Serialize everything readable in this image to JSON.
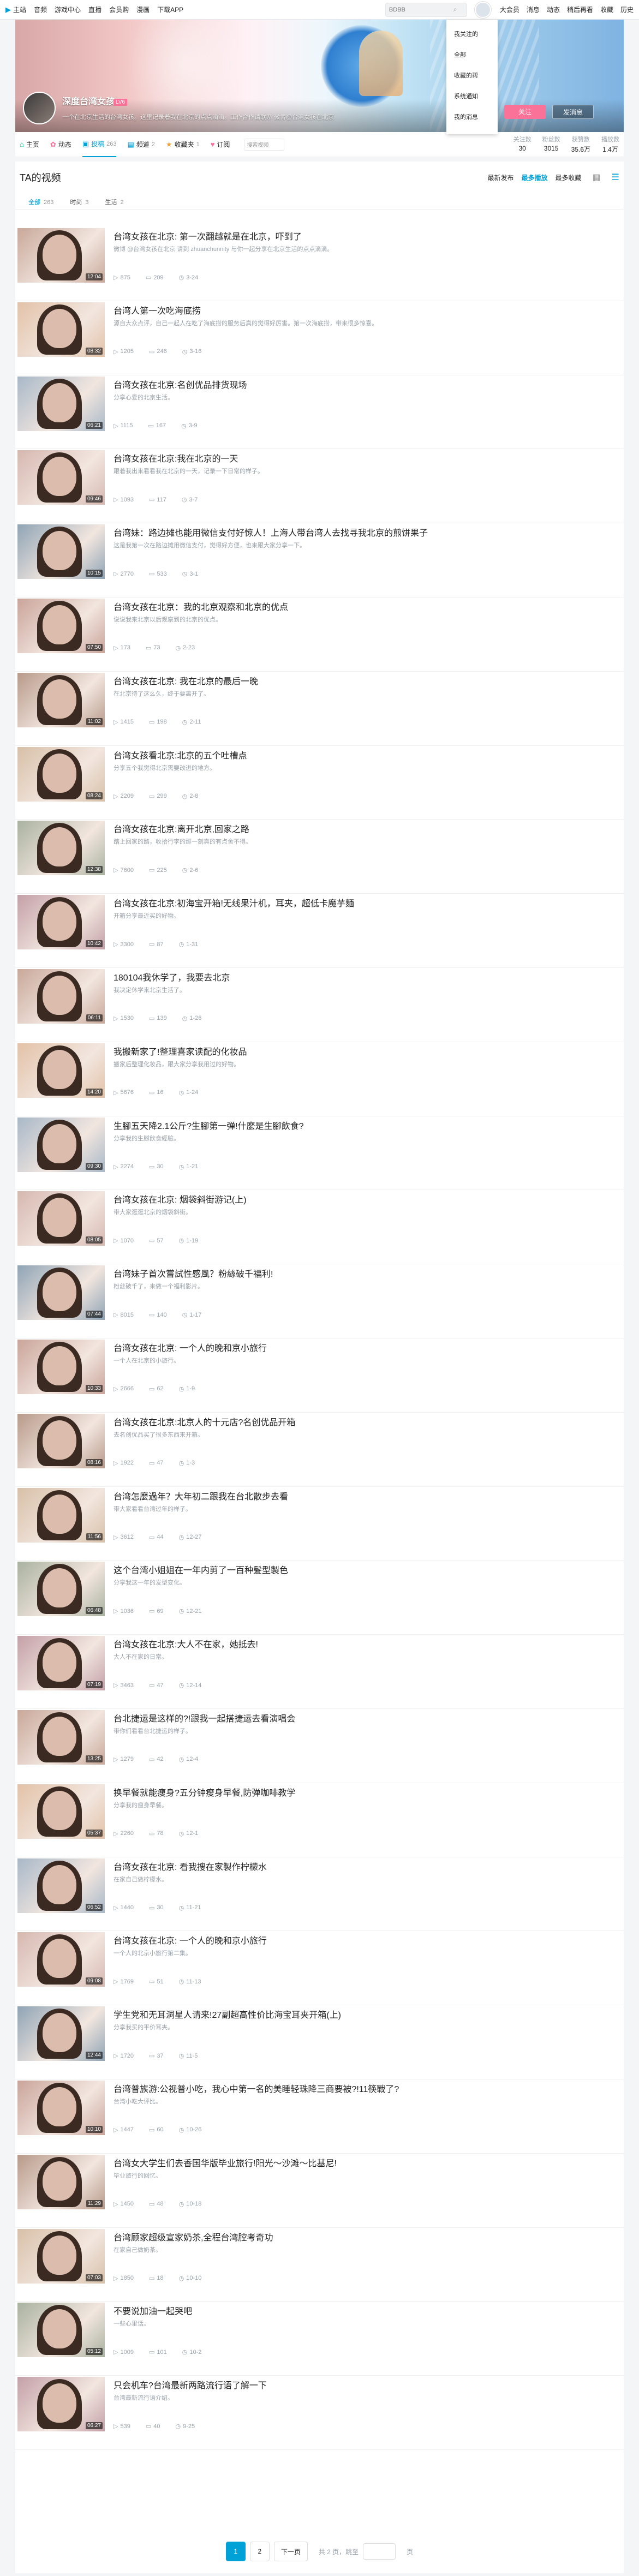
{
  "topbar": {
    "links": [
      "主站",
      "音频",
      "游戏中心",
      "直播",
      "会员购",
      "漫画",
      "下载APP"
    ],
    "search_placeholder": "BDBB",
    "right": [
      "大会员",
      "消息",
      "动态",
      "稍后再看",
      "收藏",
      "历史"
    ]
  },
  "dropdown": {
    "items": [
      "我关注的",
      "全部",
      "收藏的帮",
      "系统通知",
      "我的消息"
    ]
  },
  "banner": {
    "username": "深度台湾女孩",
    "level": "LV6",
    "sign": "一个在北京生活的台湾女孩。这里记录着我在北京的点点滴滴。工作合作请联系 微博@台湾女孩在北京",
    "follow": "关注",
    "message": "发消息"
  },
  "nav": {
    "tabs": [
      {
        "label": "主页",
        "count": ""
      },
      {
        "label": "动态",
        "count": ""
      },
      {
        "label": "投稿",
        "count": "263"
      },
      {
        "label": "频道",
        "count": "2"
      },
      {
        "label": "收藏夹",
        "count": "1"
      },
      {
        "label": "订阅",
        "count": ""
      }
    ],
    "search_placeholder": "搜索视频",
    "stats": [
      {
        "label": "关注数",
        "value": "30"
      },
      {
        "label": "粉丝数",
        "value": "3015"
      },
      {
        "label": "获赞数",
        "value": "35.6万"
      },
      {
        "label": "播放数",
        "value": "1.4万"
      }
    ]
  },
  "main": {
    "title": "TA的视频",
    "sorts": [
      "最新发布",
      "最多播放",
      "最多收藏"
    ],
    "filters": [
      {
        "label": "全部",
        "count": "263"
      },
      {
        "label": "时尚",
        "count": "3"
      },
      {
        "label": "生活",
        "count": "2"
      }
    ]
  },
  "videos": [
    {
      "title": "台湾女孩在北京: 第一次翻越就是在北京，吓到了",
      "desc": "微博 @台湾女孩在北京 请到 zhuanchunnity 与你一起分享在北京生活的点点滴滴。",
      "plays": "875",
      "comments": "209",
      "date": "3-24",
      "dur": "12:04"
    },
    {
      "title": "台湾人第一次吃海底捞",
      "desc": "源自大众点评，自己一起人在吃了海底捞的服务后真的觉得好厉害。第一次海底捞，带来很多惊喜。",
      "plays": "1205",
      "comments": "246",
      "date": "3-16",
      "dur": "08:32"
    },
    {
      "title": "台湾女孩在北京:名创优品排货现场",
      "desc": "分享心爱的北京生活。",
      "plays": "1115",
      "comments": "167",
      "date": "3-9",
      "dur": "06:21"
    },
    {
      "title": "台湾女孩在北京:我在北京的一天",
      "desc": "跟着我出来看看我在北京的一天，记录一下日常的样子。",
      "plays": "1093",
      "comments": "117",
      "date": "3-7",
      "dur": "09:46"
    },
    {
      "title": "台湾妹：路边摊也能用微信支付好惊人！上海人带台湾人去找寻我北京的煎饼果子",
      "desc": "这是我第一次在路边摊用微信支付，觉得好方便，也来跟大家分享一下。",
      "plays": "2770",
      "comments": "533",
      "date": "3-1",
      "dur": "10:15"
    },
    {
      "title": "台湾女孩在北京：我的北京观察和北京的优点",
      "desc": "说说我来北京以后观察到的北京的优点。",
      "plays": "173",
      "comments": "73",
      "date": "2-23",
      "dur": "07:50"
    },
    {
      "title": "台湾女孩在北京: 我在北京的最后一晚",
      "desc": "在北京待了这么久，终于要离开了。",
      "plays": "1415",
      "comments": "198",
      "date": "2-11",
      "dur": "11:02"
    },
    {
      "title": "台湾女孩看北京:北京的五个吐槽点",
      "desc": "分享五个我觉得北京需要改进的地方。",
      "plays": "2209",
      "comments": "299",
      "date": "2-8",
      "dur": "08:24"
    },
    {
      "title": "台湾女孩在北京:离开北京,回家之路",
      "desc": "踏上回家的路，收拾行李的那一刻真的有点舍不得。",
      "plays": "7600",
      "comments": "225",
      "date": "2-6",
      "dur": "12:38"
    },
    {
      "title": "台湾女孩在北京:初海宝开箱!无线果汁机，耳夹，超低卡魔芋麵",
      "desc": "开箱分享最近买的好物。",
      "plays": "3300",
      "comments": "87",
      "date": "1-31",
      "dur": "10:42"
    },
    {
      "title": "180104我休学了，我要去北京",
      "desc": "我决定休学来北京生活了。",
      "plays": "1530",
      "comments": "139",
      "date": "1-26",
      "dur": "06:11"
    },
    {
      "title": "我搬新家了!整理喜家读配的化妆品",
      "desc": "搬家后整理化妆品，跟大家分享我用过的好物。",
      "plays": "5676",
      "comments": "16",
      "date": "1-24",
      "dur": "14:20"
    },
    {
      "title": "生腳五天降2.1公斤?生腳第一弹!什麼是生腳飲食?",
      "desc": "分享我的生腳飲食經驗。",
      "plays": "2274",
      "comments": "30",
      "date": "1-21",
      "dur": "09:30"
    },
    {
      "title": "台湾女孩在北京: 烟袋斜街游记(上)",
      "desc": "带大家逛逛北京的烟袋斜街。",
      "plays": "1070",
      "comments": "57",
      "date": "1-19",
      "dur": "08:05"
    },
    {
      "title": "台湾妹子首次嘗試性感風？粉絲破千福利!",
      "desc": "粉丝破千了，来做一个福利影片。",
      "plays": "8015",
      "comments": "140",
      "date": "1-17",
      "dur": "07:44"
    },
    {
      "title": "台湾女孩在北京: 一个人的晚和京小旅行",
      "desc": "一个人在北京的小旅行。",
      "plays": "2666",
      "comments": "62",
      "date": "1-9",
      "dur": "10:33"
    },
    {
      "title": "台湾女孩在北京:北京人的十元店?名创优品开箱",
      "desc": "去名创优品买了很多东西来开箱。",
      "plays": "1922",
      "comments": "47",
      "date": "1-3",
      "dur": "08:16"
    },
    {
      "title": "台湾怎麼過年？大年初二跟我在台北散步去看",
      "desc": "带大家看看台湾过年的样子。",
      "plays": "3612",
      "comments": "44",
      "date": "12-27",
      "dur": "11:56"
    },
    {
      "title": "这个台湾小姐姐在一年内剪了一百种髮型製色",
      "desc": "分享我这一年的发型变化。",
      "plays": "1036",
      "comments": "69",
      "date": "12-21",
      "dur": "06:48"
    },
    {
      "title": "台湾女孩在北京:大人不在家，她抵去!",
      "desc": "大人不在家的日常。",
      "plays": "3463",
      "comments": "47",
      "date": "12-14",
      "dur": "07:19"
    },
    {
      "title": "台北捷运是这样的?!跟我一起搭捷运去看演唱会",
      "desc": "带你们看看台北捷运的样子。",
      "plays": "1279",
      "comments": "42",
      "date": "12-4",
      "dur": "13:25"
    },
    {
      "title": "换早餐就能瘦身?五分钟瘦身早餐,防弹咖啡教学",
      "desc": "分享我的瘦身早餐。",
      "plays": "2260",
      "comments": "78",
      "date": "12-1",
      "dur": "05:37"
    },
    {
      "title": "台湾女孩在北京: 看我搜在家製作柠檬水",
      "desc": "在家自己做柠檬水。",
      "plays": "1440",
      "comments": "30",
      "date": "11-21",
      "dur": "06:52"
    },
    {
      "title": "台湾女孩在北京: 一个人的晚和京小旅行",
      "desc": "一个人的北京小旅行第二集。",
      "plays": "1769",
      "comments": "51",
      "date": "11-13",
      "dur": "09:08"
    },
    {
      "title": "学生党和无耳洞星人请来!27副超高性价比海宝耳夹开箱(上)",
      "desc": "分享我买的平价耳夹。",
      "plays": "1720",
      "comments": "37",
      "date": "11-5",
      "dur": "12:44"
    },
    {
      "title": "台湾普族游:公视普小吃，我心中第一名的美睡轻珠降三商要被?!11筷戰了?",
      "desc": "台湾小吃大评比。",
      "plays": "1447",
      "comments": "60",
      "date": "10-26",
      "dur": "10:10"
    },
    {
      "title": "台湾女大学生们去香国华版毕业旅行!阳光～沙滩～比基尼!",
      "desc": "毕业旅行的回忆。",
      "plays": "1450",
      "comments": "48",
      "date": "10-18",
      "dur": "11:29"
    },
    {
      "title": "台湾顾家超级宣家奶茶,全程台湾腔考奇功",
      "desc": "在家自己做奶茶。",
      "plays": "1850",
      "comments": "18",
      "date": "10-10",
      "dur": "07:03"
    },
    {
      "title": "不要说加油一起哭吧",
      "desc": "一些心里话。",
      "plays": "1009",
      "comments": "101",
      "date": "10-2",
      "dur": "05:12"
    },
    {
      "title": "只会机车?台湾最新两路流行语了解一下",
      "desc": "台湾最新流行语介绍。",
      "plays": "539",
      "comments": "40",
      "date": "9-25",
      "dur": "06:27"
    }
  ],
  "pager": {
    "pages": [
      "1",
      "2"
    ],
    "next": "下一页",
    "info": "共 2 页，跳至",
    "unit": "页"
  },
  "colors": {
    "accent": "#00a1d6",
    "pink": "#fb7299"
  }
}
